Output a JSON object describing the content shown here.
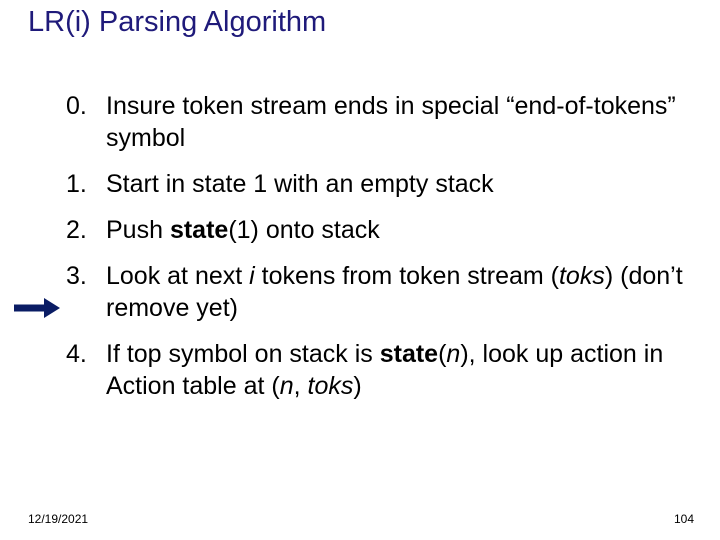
{
  "title": {
    "text": "LR(i) Parsing Algorithm",
    "color": "#1F1A7A"
  },
  "items": [
    {
      "num": "0.",
      "parts": [
        {
          "t": "Insure token stream ends in special “end-of-tokens” symbol"
        }
      ]
    },
    {
      "num": "1.",
      "parts": [
        {
          "t": "Start in state 1 with an empty stack"
        }
      ]
    },
    {
      "num": "2.",
      "parts": [
        {
          "t": "Push "
        },
        {
          "t": "state",
          "b": true
        },
        {
          "t": "(1) onto stack"
        }
      ]
    },
    {
      "num": "3.",
      "parts": [
        {
          "t": "Look at next "
        },
        {
          "t": "i ",
          "i": true
        },
        {
          "t": "tokens from token stream ("
        },
        {
          "t": "toks",
          "i": true
        },
        {
          "t": ") (don’t remove yet)"
        }
      ]
    },
    {
      "num": "4.",
      "parts": [
        {
          "t": "If top symbol on stack is "
        },
        {
          "t": "state",
          "b": true
        },
        {
          "t": "("
        },
        {
          "t": "n",
          "i": true
        },
        {
          "t": "), look up action in  Action table at ("
        },
        {
          "t": "n",
          "i": true
        },
        {
          "t": ", "
        },
        {
          "t": "toks",
          "i": true
        },
        {
          "t": ")"
        }
      ]
    }
  ],
  "arrow": {
    "color": "#0A1C64"
  },
  "footer": {
    "date": "12/19/2021",
    "page": "104"
  }
}
